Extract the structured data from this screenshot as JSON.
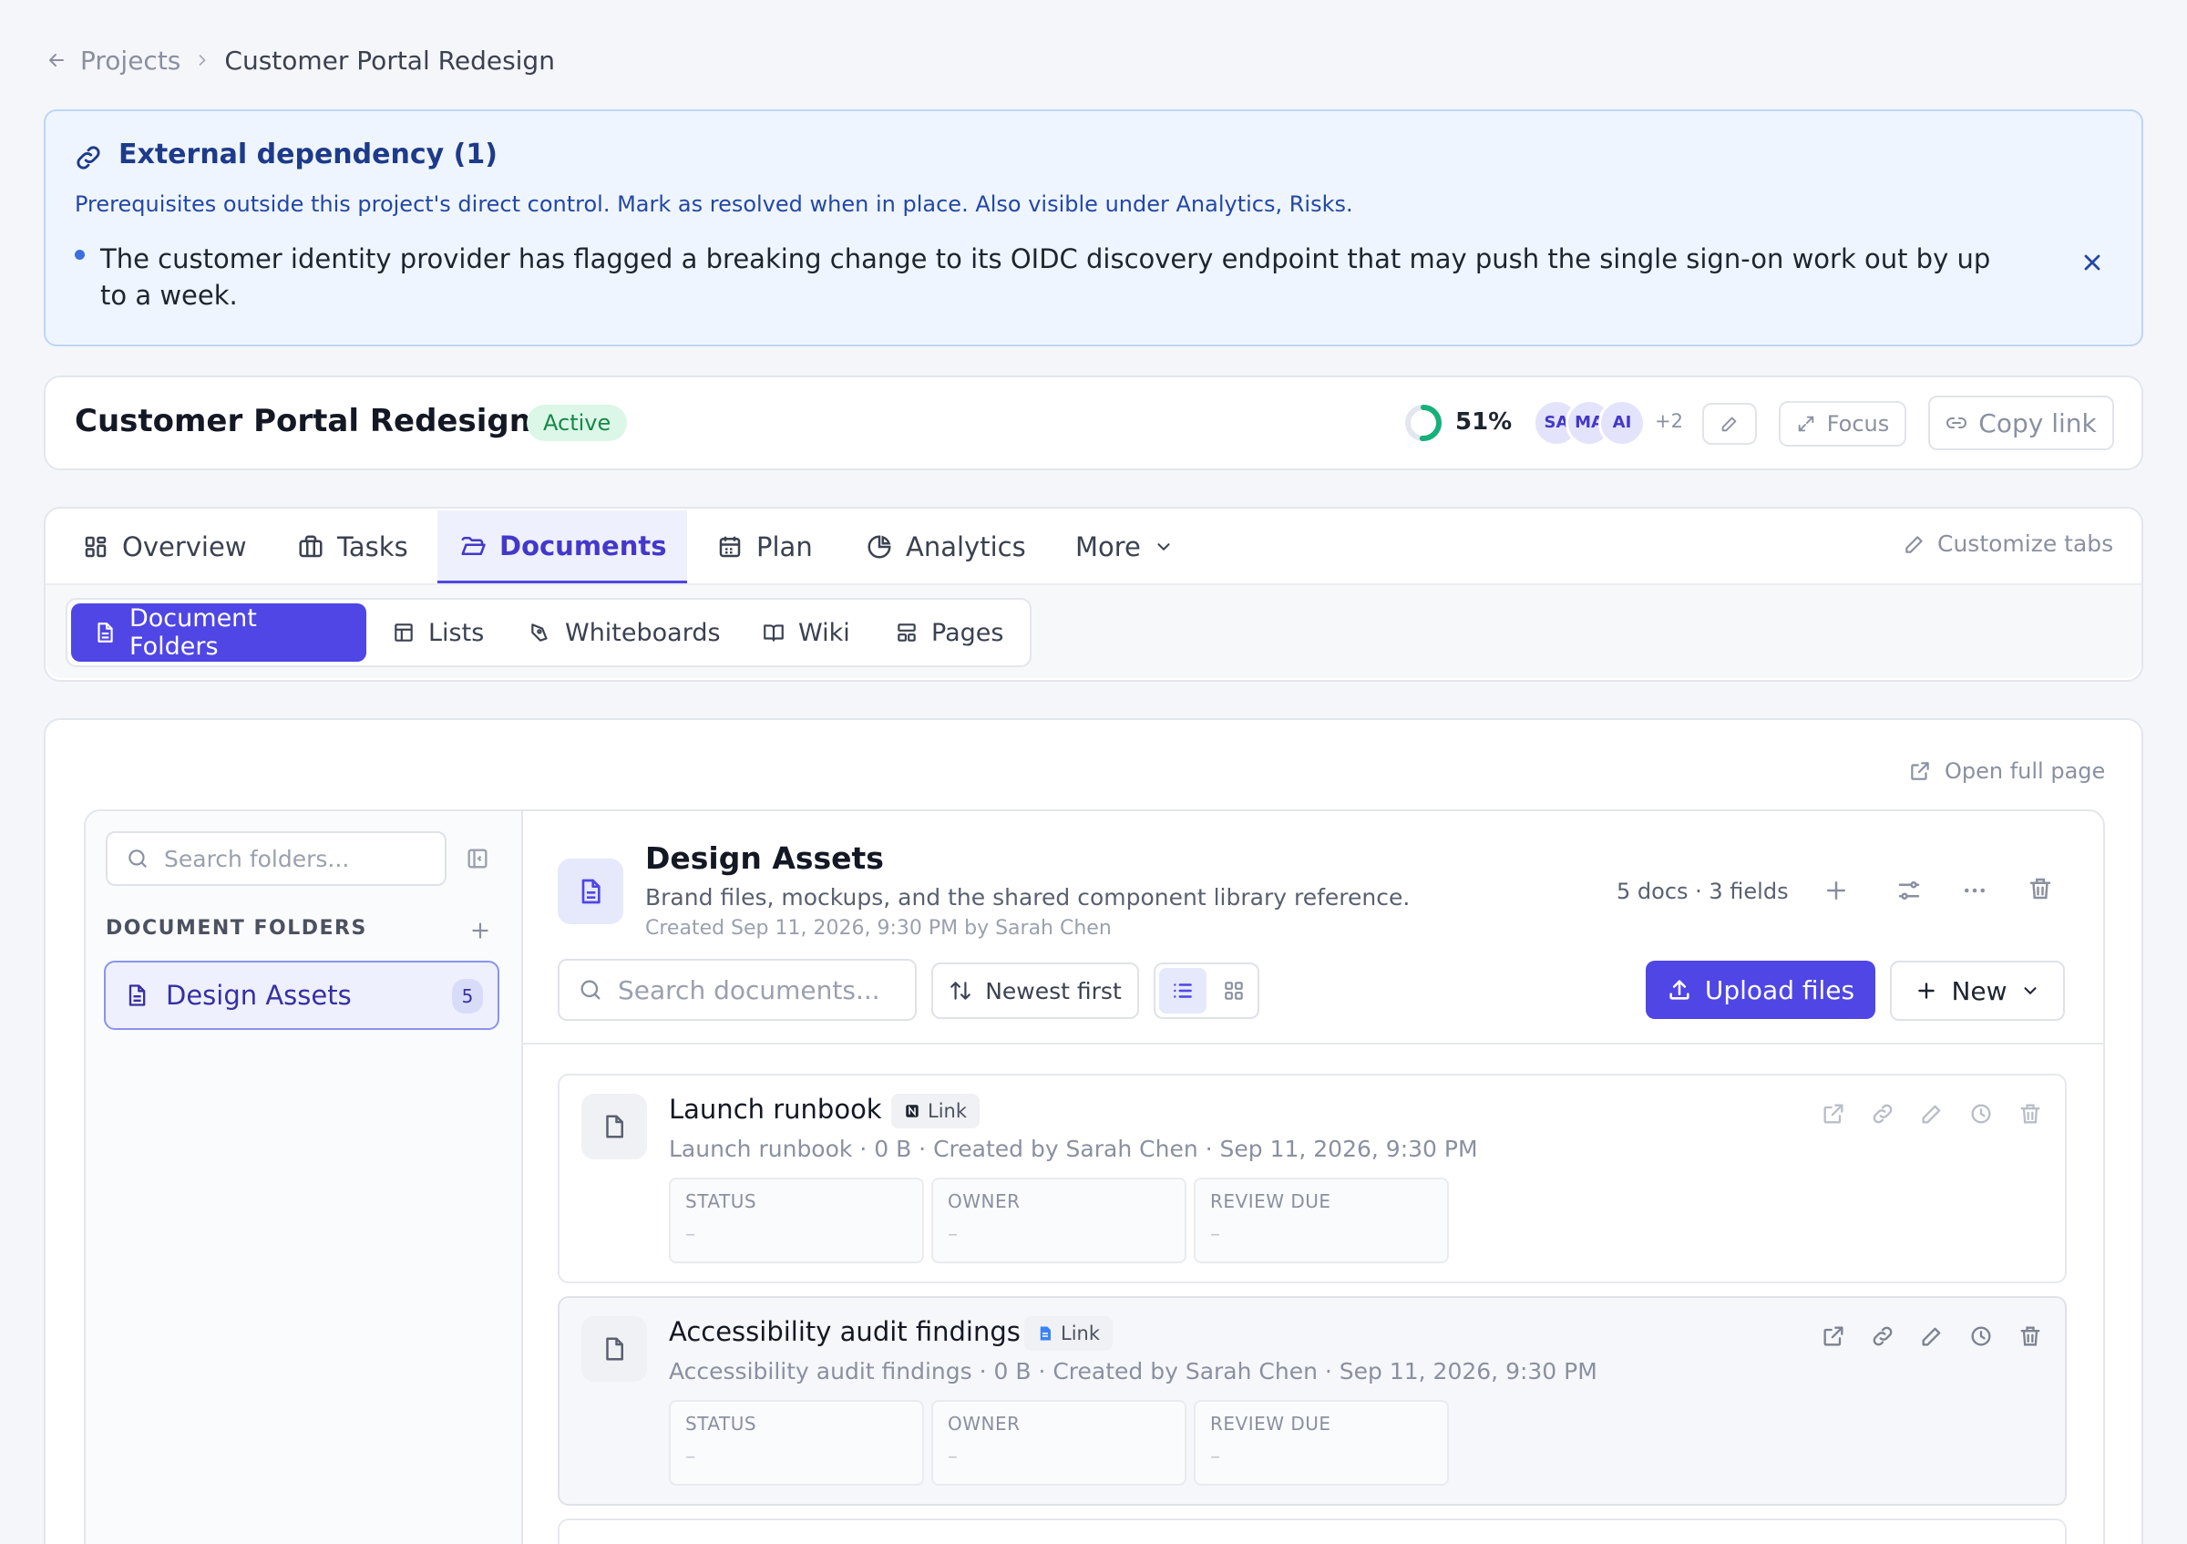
{
  "breadcrumb": {
    "parent": "Projects",
    "current": "Customer Portal Redesign"
  },
  "alert": {
    "title": "External dependency (1)",
    "subtitle": "Prerequisites outside this project's direct control. Mark as resolved when in place. Also visible under Analytics, Risks.",
    "item": "The customer identity provider has flagged a breaking change to its OIDC discovery endpoint that may push the single sign-on work out by up to a week."
  },
  "project": {
    "title": "Customer Portal Redesign",
    "status": "Active",
    "progress": 51,
    "progress_label": "51%",
    "avatars": [
      "SA",
      "MA",
      "AI"
    ],
    "more_members": "+2",
    "focus_label": "Focus",
    "copy_link_label": "Copy link"
  },
  "tabs": {
    "items": [
      "Overview",
      "Tasks",
      "Documents",
      "Plan",
      "Analytics",
      "More"
    ],
    "active": "Documents",
    "customize_label": "Customize tabs"
  },
  "subtabs": {
    "items": [
      "Document Folders",
      "Lists",
      "Whiteboards",
      "Wiki",
      "Pages"
    ],
    "active": "Document Folders"
  },
  "panel": {
    "open_full_label": "Open full page",
    "folder_search_placeholder": "Search folders...",
    "section_label": "DOCUMENT FOLDERS",
    "folders": [
      {
        "name": "Design Assets",
        "count": "5"
      }
    ]
  },
  "folder": {
    "title": "Design Assets",
    "description": "Brand files, mockups, and the shared component library reference.",
    "created": "Created Sep 11, 2026, 9:30 PM by Sarah Chen",
    "stats": "5 docs · 3 fields",
    "doc_search_placeholder": "Search documents...",
    "sort_label": "Newest first",
    "upload_label": "Upload files",
    "new_label": "New"
  },
  "documents": [
    {
      "title": "Launch runbook",
      "tag": "Link",
      "meta": "Launch runbook · 0 B · Created by Sarah Chen · Sep 11, 2026, 9:30 PM",
      "fields": [
        {
          "label": "STATUS",
          "value": "–"
        },
        {
          "label": "OWNER",
          "value": "–"
        },
        {
          "label": "REVIEW DUE",
          "value": "–"
        }
      ]
    },
    {
      "title": "Accessibility audit findings",
      "tag": "Link",
      "meta": "Accessibility audit findings · 0 B · Created by Sarah Chen · Sep 11, 2026, 9:30 PM",
      "fields": [
        {
          "label": "STATUS",
          "value": "–"
        },
        {
          "label": "OWNER",
          "value": "–"
        },
        {
          "label": "REVIEW DUE",
          "value": "–"
        }
      ]
    }
  ],
  "colors": {
    "accent": "#4f46e5",
    "alert_bg": "#eef5fe",
    "status_active": "#17884a",
    "progress": "#16b07a"
  }
}
